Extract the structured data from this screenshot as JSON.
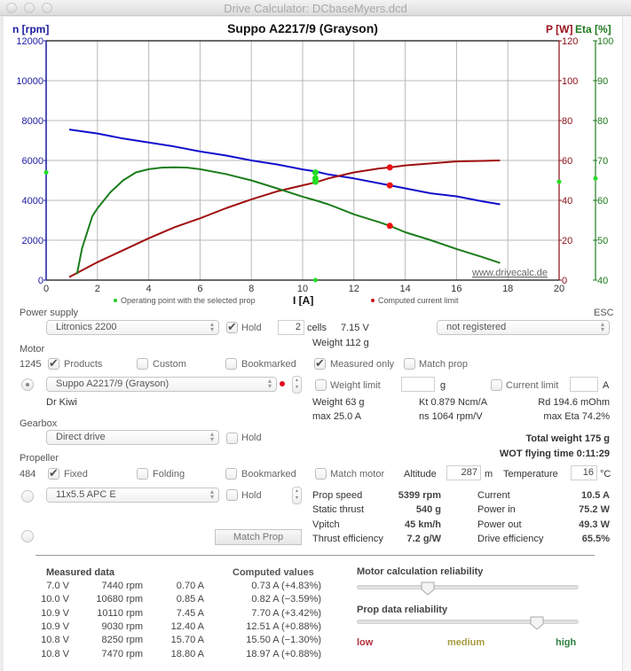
{
  "window": {
    "title": "Drive Calculator: DCbaseMyers.dcd"
  },
  "chart_data": {
    "type": "line",
    "title": "Suppo A2217/9 (Grayson)",
    "xlabel": "I [A]",
    "x_range": [
      0,
      20
    ],
    "x_ticks": [
      "0",
      "2",
      "4",
      "6",
      "8",
      "10",
      "12",
      "14",
      "16",
      "18",
      "20"
    ],
    "grid": true,
    "watermark": "www.drivecalc.de",
    "axes": {
      "left": {
        "label": "n [rpm]",
        "range": [
          0,
          12000
        ],
        "ticks": [
          "0",
          "2000",
          "4000",
          "6000",
          "8000",
          "10000",
          "12000"
        ],
        "color": "#1a1aa0"
      },
      "right1": {
        "label": "P [W]",
        "range": [
          0,
          120
        ],
        "ticks": [
          "0",
          "20",
          "40",
          "60",
          "80",
          "100",
          "120"
        ],
        "color": "#8b0d16"
      },
      "right2": {
        "label": "Eta [%]",
        "range": [
          40,
          100
        ],
        "ticks": [
          "40",
          "50",
          "60",
          "70",
          "80",
          "90",
          "100"
        ],
        "color": "#1e7a1e"
      }
    },
    "series": [
      {
        "name": "n [rpm]",
        "axis": "left",
        "color": "#1010cc",
        "x": [
          0.9,
          2,
          3,
          4,
          5,
          6,
          7,
          8,
          9,
          10,
          10.5,
          11,
          12,
          13,
          13.4,
          14,
          15,
          16,
          17,
          17.7
        ],
        "values": [
          7550,
          7350,
          7100,
          6900,
          6700,
          6450,
          6250,
          6000,
          5800,
          5550,
          5450,
          5300,
          5100,
          4850,
          4750,
          4600,
          4350,
          4200,
          3950,
          3800
        ]
      },
      {
        "name": "P [W]",
        "axis": "right1",
        "color": "#a00e0e",
        "x": [
          0.9,
          2,
          3,
          4,
          5,
          6,
          7,
          8,
          9,
          10,
          10.5,
          11,
          12,
          13,
          13.4,
          14,
          15,
          16,
          17,
          17.7
        ],
        "values": [
          1.5,
          9,
          15,
          21,
          26.5,
          31,
          36,
          40.5,
          44.5,
          47.5,
          49,
          51,
          54,
          56,
          56.5,
          57.5,
          58.5,
          59.5,
          59.8,
          60
        ]
      },
      {
        "name": "Eta [%]",
        "axis": "right2",
        "color": "#1b7d1b",
        "x": [
          1.2,
          1.4,
          1.8,
          2,
          2.5,
          3,
          3.5,
          4,
          4.5,
          5,
          5.5,
          6,
          7,
          8,
          9,
          10,
          10.5,
          11,
          12,
          13,
          13.4,
          14,
          15,
          16,
          17,
          17.7
        ],
        "values": [
          41.5,
          48,
          56,
          58,
          62,
          65,
          67,
          67.8,
          68.2,
          68.3,
          68.2,
          67.8,
          66.6,
          65,
          63,
          60.9,
          60,
          59,
          56.5,
          54.5,
          53.6,
          52,
          50,
          47.8,
          45.8,
          44.3
        ]
      }
    ],
    "operating_point": {
      "label": "Operating point with the selected prop",
      "color": "#22dd22",
      "I": 10.5,
      "rpm": 5399,
      "power_w": 49.3,
      "eta_pct": 65.5
    },
    "current_limit": {
      "label": "Computed current limit",
      "color": "#ee1111",
      "I": 13.4,
      "rpm": 4750,
      "power_w": 56.5,
      "eta_pct": 53.6
    },
    "legend_placement": "bottom"
  },
  "power_supply": {
    "section_label": "Power supply",
    "battery": "Litronics 2200",
    "hold_label": "Hold",
    "hold_checked": true,
    "cells": "2",
    "cells_label": "cells",
    "voltage": "7.15 V",
    "weight": "Weight 112 g",
    "esc_label": "ESC",
    "esc": "not registered"
  },
  "motor": {
    "section_label": "Motor",
    "count": "1245",
    "products_label": "Products",
    "products_checked": true,
    "custom_label": "Custom",
    "bookmarked_label": "Bookmarked",
    "measured_only_label": "Measured only",
    "measured_only_checked": true,
    "match_prop_label": "Match prop",
    "selected": "Suppo A2217/9 (Grayson)",
    "weight_limit_label": "Weight limit",
    "weight_limit_value": "",
    "weight_unit": "g",
    "current_limit_label": "Current limit",
    "current_limit_value": "",
    "current_unit": "A",
    "source": "Dr Kiwi",
    "weight": "Weight 63 g",
    "kt": "Kt 0.879 Ncm/A",
    "rd": "Rd 194.6 mOhm",
    "max_current": "max 25.0 A",
    "ns": "ns 1064 rpm/V",
    "max_eta": "max Eta 74.2%"
  },
  "gearbox": {
    "section_label": "Gearbox",
    "selected": "Direct drive",
    "hold_label": "Hold"
  },
  "totals": {
    "total_weight": "Total weight 175 g",
    "wot_flying_time": "WOT flying time 0:11:29"
  },
  "propeller": {
    "section_label": "Propeller",
    "count": "484",
    "fixed_label": "Fixed",
    "fixed_checked": true,
    "folding_label": "Folding",
    "bookmarked_label": "Bookmarked",
    "match_motor_label": "Match motor",
    "altitude_label": "Altitude",
    "altitude": "287",
    "altitude_unit": "m",
    "temperature_label": "Temperature",
    "temperature": "16",
    "temperature_unit": "°C",
    "selected": "11x5.5 APC E",
    "hold_label": "Hold",
    "match_prop_button": "Match Prop"
  },
  "results": {
    "left": [
      {
        "label": "Prop speed",
        "value": "5399 rpm"
      },
      {
        "label": "Static thrust",
        "value": "540 g"
      },
      {
        "label": "Vpitch",
        "value": "45 km/h"
      },
      {
        "label": "Thrust efficiency",
        "value": "7.2 g/W"
      }
    ],
    "right": [
      {
        "label": "Current",
        "value": "10.5 A"
      },
      {
        "label": "Power in",
        "value": "75.2 W"
      },
      {
        "label": "Power out",
        "value": "49.3 W"
      },
      {
        "label": "Drive efficiency",
        "value": "65.5%"
      }
    ]
  },
  "measured": {
    "header_measured": "Measured data",
    "header_computed": "Computed values",
    "rows": [
      {
        "voltage": "7.0 V",
        "rpm": "7440 rpm",
        "current": "0.70 A",
        "computed": "0.73 A (+4.83%)"
      },
      {
        "voltage": "10.0 V",
        "rpm": "10680 rpm",
        "current": "0.85 A",
        "computed": "0.82 A (−3.59%)"
      },
      {
        "voltage": "10.9 V",
        "rpm": "10110 rpm",
        "current": "7.45 A",
        "computed": "7.70 A (+3.42%)"
      },
      {
        "voltage": "10.9 V",
        "rpm": "9030 rpm",
        "current": "12.40 A",
        "computed": "12.51 A (+0.88%)"
      },
      {
        "voltage": "10.8 V",
        "rpm": "8250 rpm",
        "current": "15.70 A",
        "computed": "15.50 A (−1.30%)"
      },
      {
        "voltage": "10.8 V",
        "rpm": "7470 rpm",
        "current": "18.80 A",
        "computed": "18.97 A (+0.88%)"
      }
    ]
  },
  "reliability": {
    "motor_label": "Motor calculation reliability",
    "motor_value": 0.32,
    "prop_label": "Prop data reliability",
    "prop_value": 0.81,
    "low": "low",
    "medium": "medium",
    "high": "high",
    "low_color": "#b0303a",
    "medium_color": "#a89a40",
    "high_color": "#2e8040"
  }
}
